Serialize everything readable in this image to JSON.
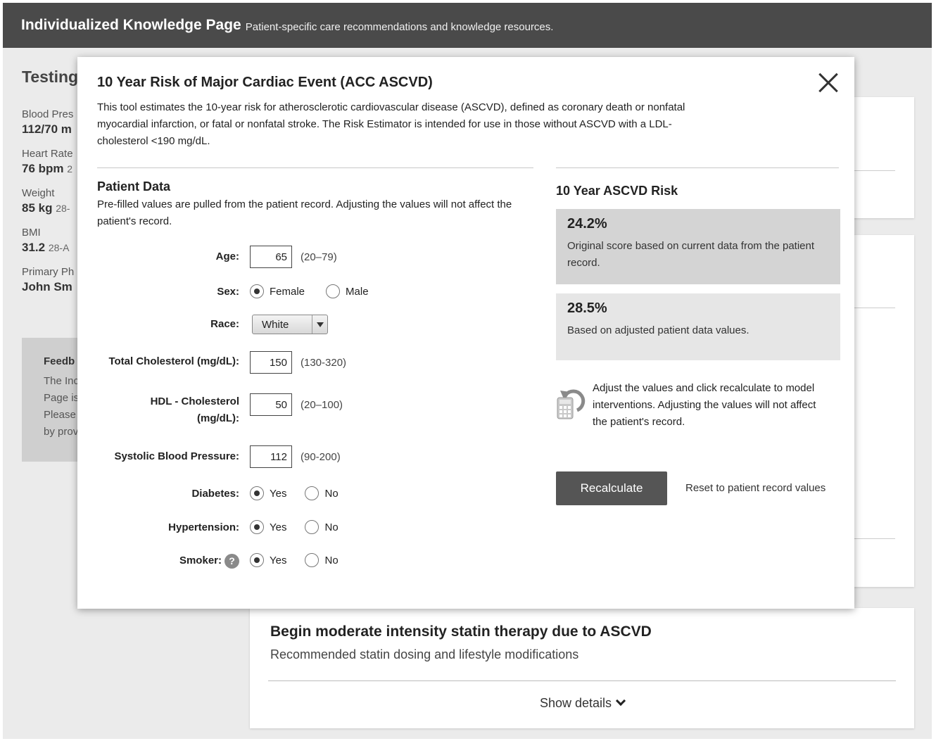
{
  "header": {
    "title": "Individualized Knowledge Page",
    "subtitle": "Patient-specific care recommendations and knowledge resources."
  },
  "background": {
    "heading": "Testing",
    "vitals": [
      {
        "label": "Blood Pres",
        "value": "112/70 m",
        "note": ""
      },
      {
        "label": "Heart Rate",
        "value": "76 bpm",
        "note": "2"
      },
      {
        "label": "Weight",
        "value": "85 kg",
        "note": "28-"
      },
      {
        "label": "BMI",
        "value": "31.2",
        "note": "28-A"
      },
      {
        "label": "Primary Ph",
        "value": "John Sm",
        "note": ""
      }
    ],
    "feedback": {
      "heading": "Feedb",
      "lines": [
        "The Inc",
        "Page is",
        "Please",
        "by prov"
      ]
    },
    "card": {
      "title": "Begin moderate intensity statin therapy due to ASCVD",
      "subtitle": "Recommended statin dosing and lifestyle modifications",
      "show_details": "Show details"
    }
  },
  "modal": {
    "title": "10 Year Risk of Major Cardiac Event (ACC ASCVD)",
    "description": "This tool estimates the 10-year risk for atherosclerotic cardiovascular disease (ASCVD), defined as coronary death or nonfatal myocardial infarction, or fatal or nonfatal stroke. The Risk Estimator is intended for use in those without ASCVD with a LDL-cholesterol <190 mg/dL.",
    "patient_data": {
      "title": "Patient Data",
      "description": "Pre-filled values are pulled from the patient record. Adjusting the values will not affect the patient's record.",
      "age": {
        "label": "Age:",
        "value": "65",
        "range": "(20–79)"
      },
      "sex": {
        "label": "Sex:",
        "options": [
          "Female",
          "Male"
        ],
        "selected": "Female"
      },
      "race": {
        "label": "Race:",
        "value": "White"
      },
      "total_cholesterol": {
        "label": "Total Cholesterol (mg/dL):",
        "value": "150",
        "range": "(130-320)"
      },
      "hdl": {
        "label_line1": "HDL - Cholesterol",
        "label_line2": "(mg/dL):",
        "value": "50",
        "range": "(20–100)"
      },
      "sbp": {
        "label": "Systolic Blood Pressure:",
        "value": "112",
        "range": "(90-200)"
      },
      "diabetes": {
        "label": "Diabetes:",
        "yes": "Yes",
        "no": "No",
        "selected": "Yes"
      },
      "hypertension": {
        "label": "Hypertension:",
        "yes": "Yes",
        "no": "No",
        "selected": "Yes"
      },
      "smoker": {
        "label": "Smoker:",
        "help": "?",
        "yes": "Yes",
        "no": "No",
        "selected": "Yes"
      }
    },
    "risk": {
      "title": "10 Year ASCVD Risk",
      "original": {
        "value": "24.2%",
        "description": "Original score based on current data from the patient record."
      },
      "adjusted": {
        "value": "28.5%",
        "description": "Based on adjusted patient data values."
      },
      "note": "Adjust the values and click recalculate to model interventions. Adjusting the values will not affect the patient's record.",
      "recalculate_label": "Recalculate",
      "reset_label": "Reset to patient record values"
    }
  }
}
